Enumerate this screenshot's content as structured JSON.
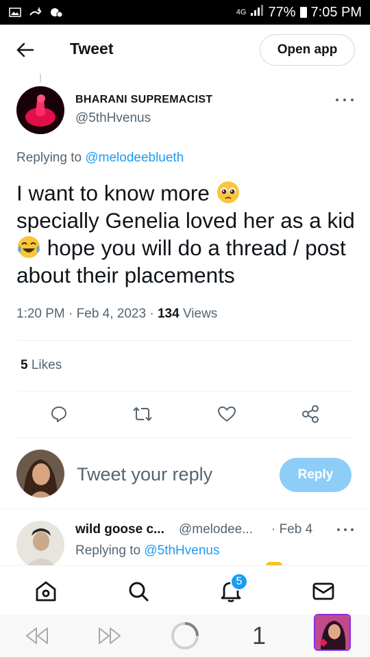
{
  "status_bar": {
    "network": "4G",
    "battery": "77%",
    "time": "7:05 PM"
  },
  "header": {
    "title": "Tweet",
    "open_app_label": "Open app"
  },
  "tweet": {
    "author_name": "BHARANI SUPREMACIST",
    "author_handle": "@5thHvenus",
    "replying_prefix": "Replying to",
    "replying_to": "@melodeeblueth",
    "text_part1": "I want to know more",
    "text_part2": "specially Genelia loved her as a kid",
    "text_part3": "hope you will do a thread / post about their placements",
    "emoji1": "pleading-face-emoji",
    "emoji2": "tears-of-joy-emoji",
    "time": "1:20 PM",
    "date": "Feb 4, 2023",
    "views_count": "134",
    "views_label": "Views",
    "likes_count": "5",
    "likes_label": "Likes"
  },
  "actions": [
    "reply-icon",
    "retweet-icon",
    "like-icon",
    "share-icon"
  ],
  "composer": {
    "placeholder": "Tweet your reply",
    "reply_label": "Reply"
  },
  "next_reply": {
    "name": "wild goose c...",
    "handle": "@melodee...",
    "date": "· Feb 4",
    "replying_prefix": "Replying to",
    "replying_to": "@5thHvenus"
  },
  "bottom_nav": {
    "items": [
      "home-icon",
      "search-icon",
      "notifications-icon",
      "messages-icon"
    ],
    "notification_badge": "5"
  },
  "browser_bar": {
    "tab_count": "1"
  },
  "colors": {
    "accent": "#1d9bf0",
    "secondary_text": "#536471",
    "reply_button_disabled": "#8ecdf8"
  }
}
